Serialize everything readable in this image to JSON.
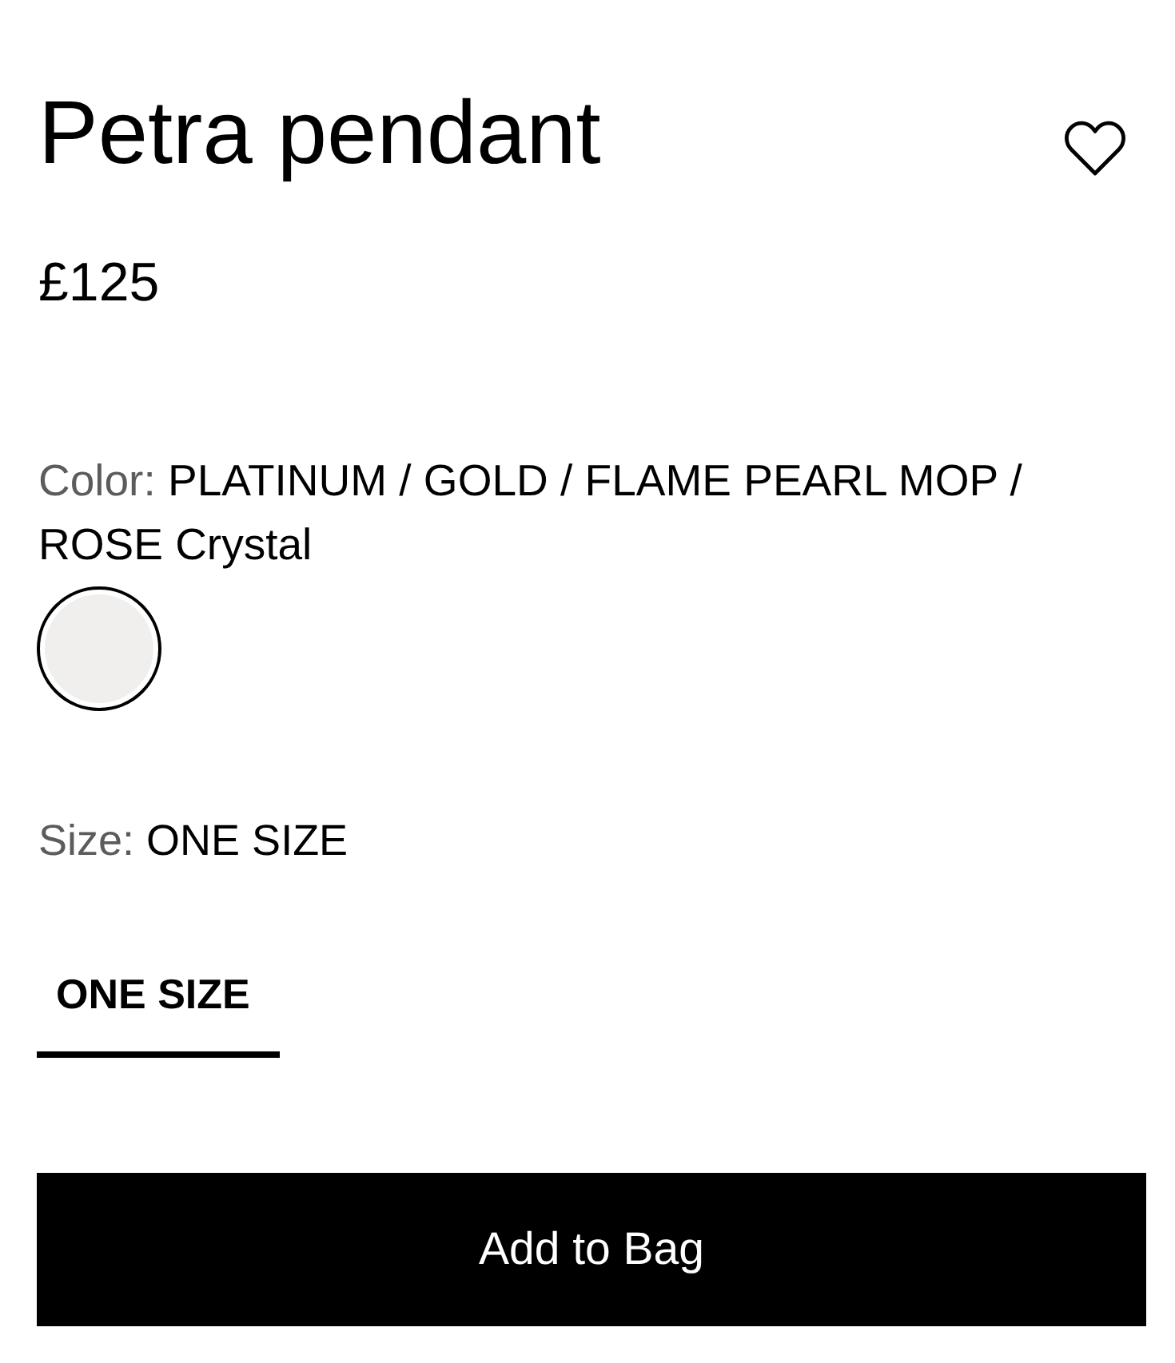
{
  "product": {
    "title": "Petra pendant",
    "price": "£125"
  },
  "color": {
    "label": "Color:",
    "value": "PLATINUM / GOLD / FLAME PEARL MOP / ROSE Crystal",
    "swatches": [
      {
        "color": "#f0efed",
        "selected": true
      }
    ]
  },
  "size": {
    "label": "Size:",
    "value": "ONE SIZE",
    "options": [
      {
        "label": "ONE SIZE",
        "selected": true
      }
    ]
  },
  "button": {
    "label": "Add to Bag"
  }
}
